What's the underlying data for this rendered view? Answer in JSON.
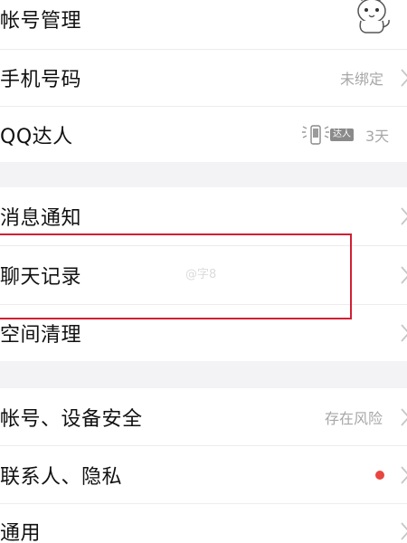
{
  "settings": {
    "group1": [
      {
        "label": "帐号管理",
        "value": "",
        "icon": "avatar-cat"
      },
      {
        "label": "手机号码",
        "value": "未绑定"
      },
      {
        "label": "QQ达人",
        "badge_text": "达人",
        "value": "3天",
        "icon": "qq-talent-badge"
      }
    ],
    "group2": [
      {
        "label": "消息通知"
      },
      {
        "label": "聊天记录"
      },
      {
        "label": "空间清理"
      }
    ],
    "group3": [
      {
        "label": "帐号、设备安全",
        "value": "存在风险"
      },
      {
        "label": "联系人、隐私",
        "dot_color": "#e8463f"
      },
      {
        "label": "通用"
      }
    ]
  },
  "overlay": {
    "highlight_color": "#d11f33",
    "watermark": "@字8"
  }
}
